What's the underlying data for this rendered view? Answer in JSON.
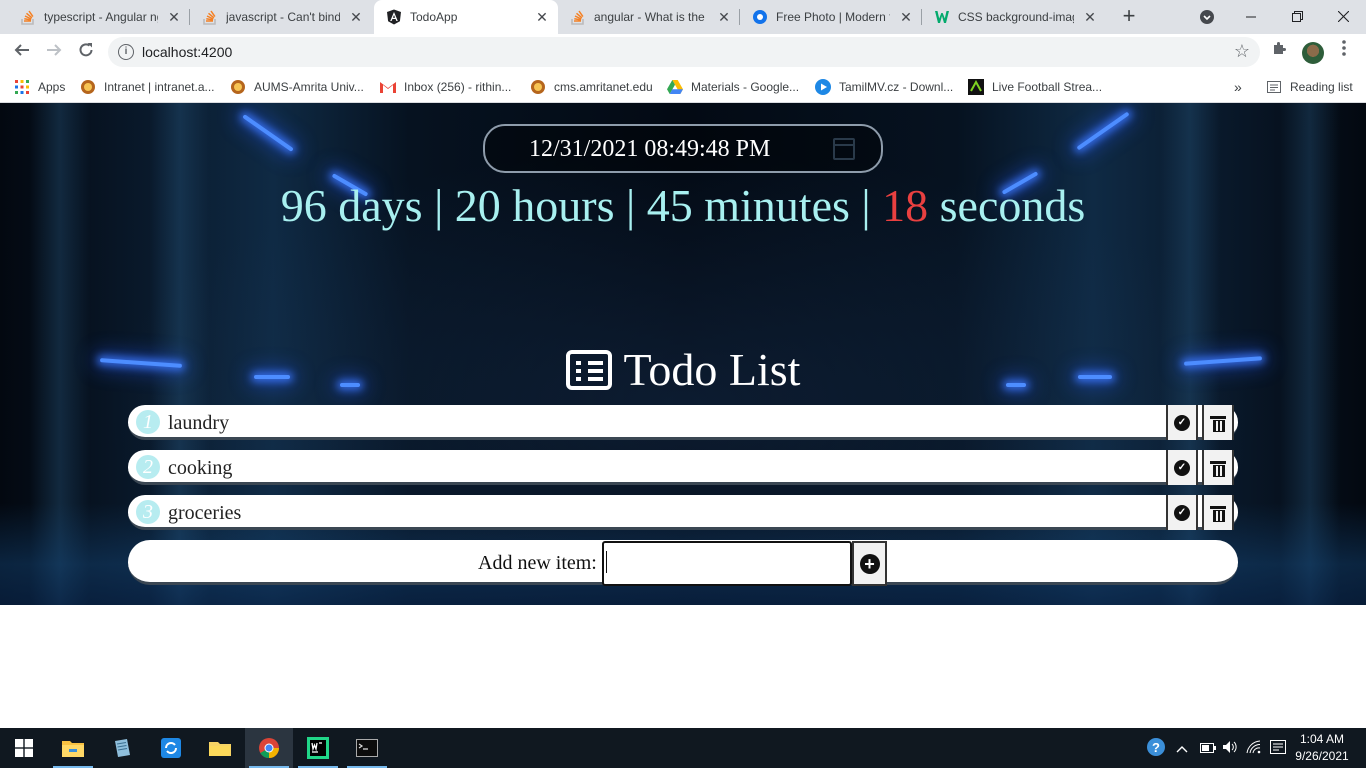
{
  "browser": {
    "tabs": [
      {
        "title": "typescript - Angular ng",
        "favicon": "stackoverflow-icon",
        "active": false
      },
      {
        "title": "javascript - Can't bind",
        "favicon": "stackoverflow-icon",
        "active": false
      },
      {
        "title": "TodoApp",
        "favicon": "angular-icon",
        "active": true
      },
      {
        "title": "angular - What is the t",
        "favicon": "stackoverflow-icon",
        "active": false
      },
      {
        "title": "Free Photo | Modern fu",
        "favicon": "freepik-icon",
        "active": false
      },
      {
        "title": "CSS background-imag",
        "favicon": "w3schools-icon",
        "active": false
      }
    ],
    "close_glyph": "✕",
    "new_tab_glyph": "+",
    "url": "localhost:4200",
    "bookmarks": [
      {
        "label": "Apps",
        "icon": "apps-grid-icon"
      },
      {
        "label": "Intranet | intranet.a...",
        "icon": "amrita-icon"
      },
      {
        "label": "AUMS-Amrita Univ...",
        "icon": "amrita-icon"
      },
      {
        "label": "Inbox (256) - rithin...",
        "icon": "gmail-icon"
      },
      {
        "label": "cms.amritanet.edu",
        "icon": "amrita-icon"
      },
      {
        "label": "Materials - Google...",
        "icon": "google-drive-icon"
      },
      {
        "label": "TamilMV.cz - Downl...",
        "icon": "play-icon"
      },
      {
        "label": "Live Football Strea...",
        "icon": "football-icon"
      }
    ],
    "bookmarks_overflow": "»",
    "reading_list": "Reading list"
  },
  "app": {
    "date_value": "12/31/2021 08:49:48 PM",
    "countdown": {
      "days": "96 days",
      "sep1": " | ",
      "hours": "20 hours",
      "sep2": " | ",
      "minutes": "45 minutes",
      "sep3": " | ",
      "seconds_number": "18",
      "seconds_label": " seconds"
    },
    "title": "Todo List",
    "items": [
      {
        "num": "1",
        "text": "laundry"
      },
      {
        "num": "2",
        "text": "cooking"
      },
      {
        "num": "3",
        "text": "groceries"
      }
    ],
    "add_label": "Add new item:",
    "add_input_value": ""
  },
  "colors": {
    "countdown_text": "#a8f0f0",
    "seconds_highlight": "#e94040",
    "item_number_bg": "#b7ecf0"
  },
  "taskbar": {
    "apps": [
      "start-icon",
      "file-explorer-icon",
      "notepad-icon",
      "sync-icon",
      "folder-icon",
      "chrome-icon",
      "webstorm-icon",
      "terminal-icon"
    ],
    "time": "1:04 AM",
    "date": "9/26/2021"
  }
}
